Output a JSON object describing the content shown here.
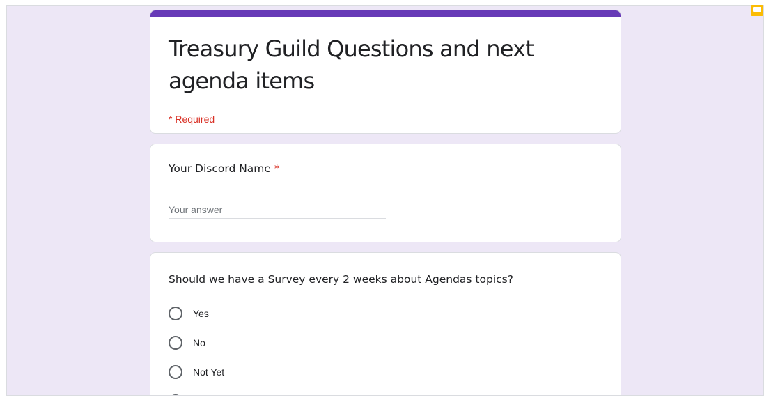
{
  "form": {
    "title": "Treasury Guild Questions and next agenda items",
    "required_note": "* Required"
  },
  "questions": [
    {
      "title": "Your Discord Name",
      "required_mark": "*",
      "placeholder": "Your answer"
    },
    {
      "title": "Should we have a Survey every 2 weeks about Agendas topics?",
      "options": [
        "Yes",
        "No",
        "Not Yet"
      ]
    }
  ],
  "colors": {
    "accent": "#673ab7",
    "background": "#ede7f6",
    "required": "#d93025",
    "slides_icon": "#fbbc04"
  },
  "icons": [
    "slides-icon",
    "radio-unchecked-icon"
  ]
}
